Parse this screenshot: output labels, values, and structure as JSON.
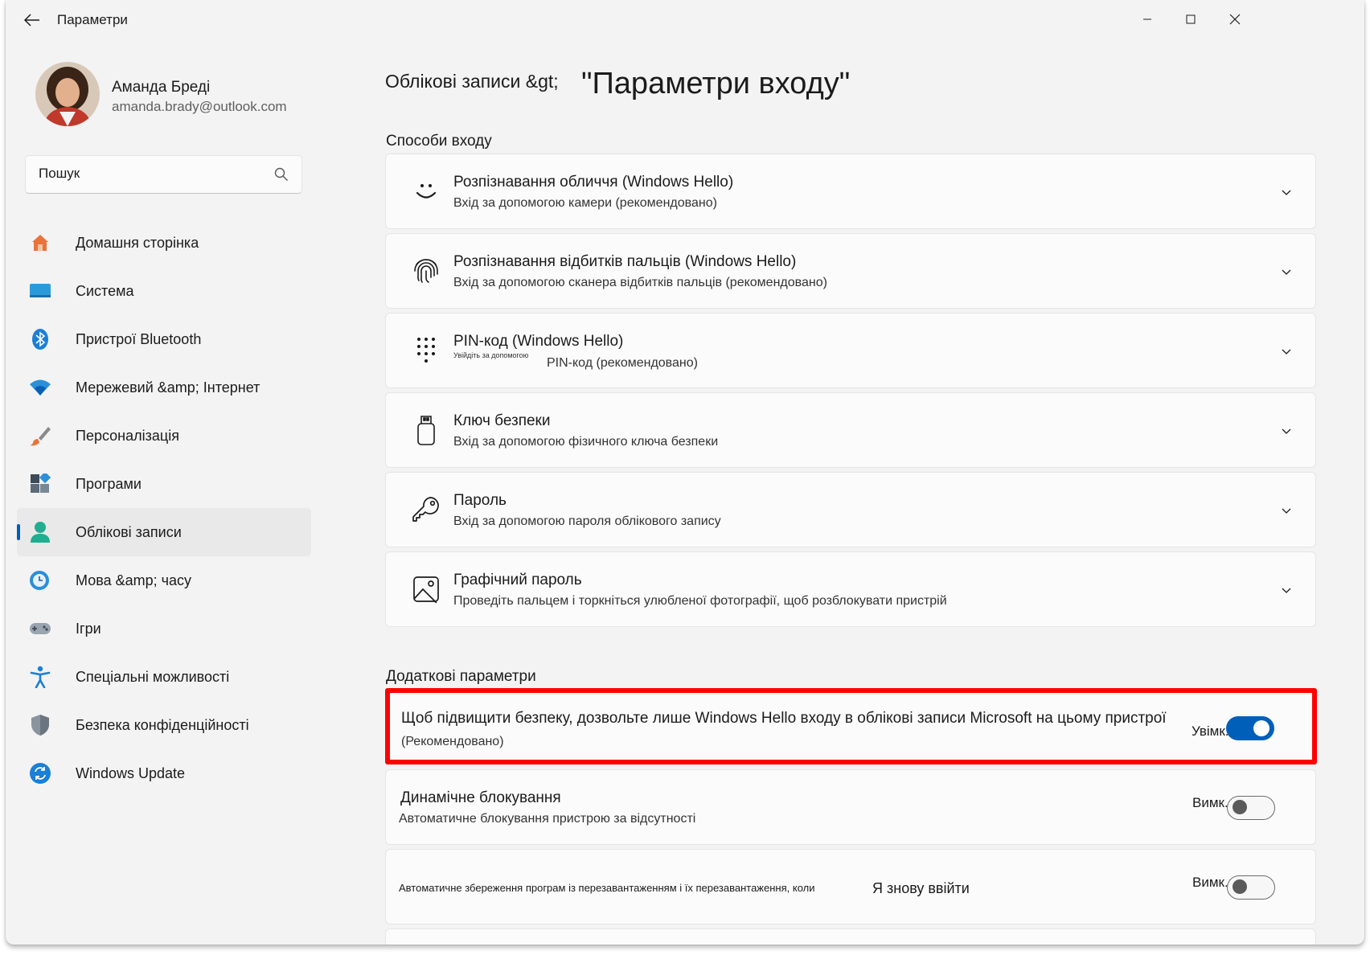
{
  "window": {
    "title": "Параметри"
  },
  "profile": {
    "name": "Аманда Бреді",
    "email": "amanda.brady@outlook.com"
  },
  "search": {
    "placeholder": "Пошук"
  },
  "nav": [
    {
      "id": "home",
      "label": "Домашня сторінка",
      "icon": "home-icon"
    },
    {
      "id": "system",
      "label": "Система",
      "icon": "display-icon"
    },
    {
      "id": "bluetooth",
      "label": "Пристрої Bluetooth",
      "icon": "bluetooth-icon"
    },
    {
      "id": "network",
      "label": "Мережевий &amp; Інтернет",
      "icon": "wifi-icon"
    },
    {
      "id": "personalization",
      "label": "Персоналізація",
      "icon": "brush-icon"
    },
    {
      "id": "apps",
      "label": "Програми",
      "icon": "apps-icon"
    },
    {
      "id": "accounts",
      "label": "Облікові записи",
      "icon": "person-icon",
      "active": true
    },
    {
      "id": "time",
      "label": "Мова &amp; часу",
      "icon": "globe-clock-icon"
    },
    {
      "id": "gaming",
      "label": "Ігри",
      "icon": "gamepad-icon"
    },
    {
      "id": "accessibility",
      "label": "Спеціальні можливості",
      "icon": "accessibility-icon"
    },
    {
      "id": "privacy",
      "label": "Безпека конфіденційності",
      "icon": "shield-icon"
    },
    {
      "id": "update",
      "label": "Windows Update",
      "icon": "update-icon"
    }
  ],
  "header": {
    "breadcrumb": "Облікові записи &gt;",
    "title": "\"Параметри входу\""
  },
  "sections": {
    "ways": "Способи входу",
    "additional": "Додаткові параметри"
  },
  "methods": [
    {
      "title": "Розпізнавання обличчя (Windows Hello)",
      "subtitle": "Вхід за допомогою камери (рекомендовано)",
      "icon": "face-icon"
    },
    {
      "title": "Розпізнавання відбитків пальців (Windows Hello)",
      "subtitle": "Вхід за допомогою сканера відбитків пальців (рекомендовано)",
      "icon": "fingerprint-icon"
    },
    {
      "title": "PIN-код (Windows Hello)",
      "subtitle_small": "Увійдіть за допомогою",
      "subtitle": "PIN-код (рекомендовано)",
      "icon": "pin-keypad-icon"
    },
    {
      "title": "Ключ безпеки",
      "subtitle": "Вхід за допомогою фізичного ключа безпеки",
      "icon": "usb-key-icon"
    },
    {
      "title": "Пароль",
      "subtitle": "Вхід за допомогою пароля облікового запису",
      "icon": "key-icon"
    },
    {
      "title": "Графічний пароль",
      "subtitle": "Проведіть пальцем і торкніться улюбленої фотографії, щоб розблокувати пристрій",
      "icon": "picture-icon"
    }
  ],
  "options": {
    "hello_only": {
      "title": "Щоб підвищити безпеку, дозвольте лише Windows Hello входу в облікові записи Microsoft на цьому пристрої",
      "subtitle": "(Рекомендовано)",
      "state_label": "Увімк.",
      "on": true
    },
    "dynamic_lock": {
      "title": "Динамічне блокування",
      "subtitle": "Автоматичне блокування пристрою за відсутності",
      "state_label": "Вимк.",
      "on": false
    },
    "restart_apps": {
      "text_small": "Автоматичне збереження програм із перезавантаженням і їх перезавантаження, коли",
      "text": "Я знову ввійти",
      "state_label": "Вимк.",
      "on": false
    }
  },
  "colors": {
    "accent": "#005fb8",
    "highlight": "#ff0000"
  }
}
